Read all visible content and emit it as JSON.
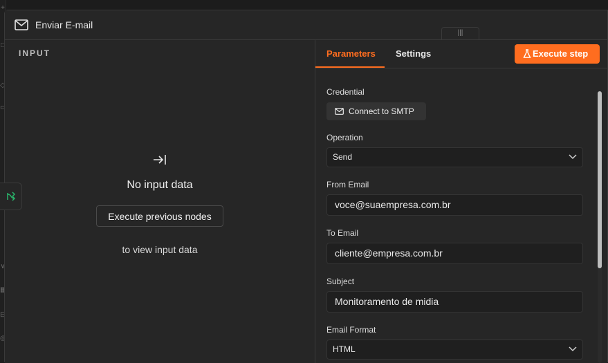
{
  "modal": {
    "title": "Enviar E-mail"
  },
  "input_panel": {
    "label": "INPUT",
    "empty_title": "No input data",
    "execute_previous_label": "Execute previous nodes",
    "hint": "to view input data"
  },
  "tabs": [
    {
      "label": "Parameters",
      "active": true
    },
    {
      "label": "Settings",
      "active": false
    }
  ],
  "execute_step_label": "Execute step",
  "fields": {
    "credential": {
      "label": "Credential",
      "button": "Connect to SMTP"
    },
    "operation": {
      "label": "Operation",
      "value": "Send"
    },
    "from_email": {
      "label": "From Email",
      "value": "voce@suaempresa.com.br"
    },
    "to_email": {
      "label": "To Email",
      "value": "cliente@empresa.com.br"
    },
    "subject": {
      "label": "Subject",
      "value": "Monitoramento de midia"
    },
    "email_format": {
      "label": "Email Format",
      "value": "HTML"
    }
  },
  "colors": {
    "accent": "#ff6d1f",
    "panel": "#262626",
    "input_bg": "#1f1f1f",
    "success": "#29b36a"
  },
  "icons": [
    "mail-icon",
    "drag-handle-icon",
    "arrow-to-right-icon",
    "flow-icon",
    "flask-icon",
    "envelope-icon",
    "chevron-down-icon"
  ]
}
